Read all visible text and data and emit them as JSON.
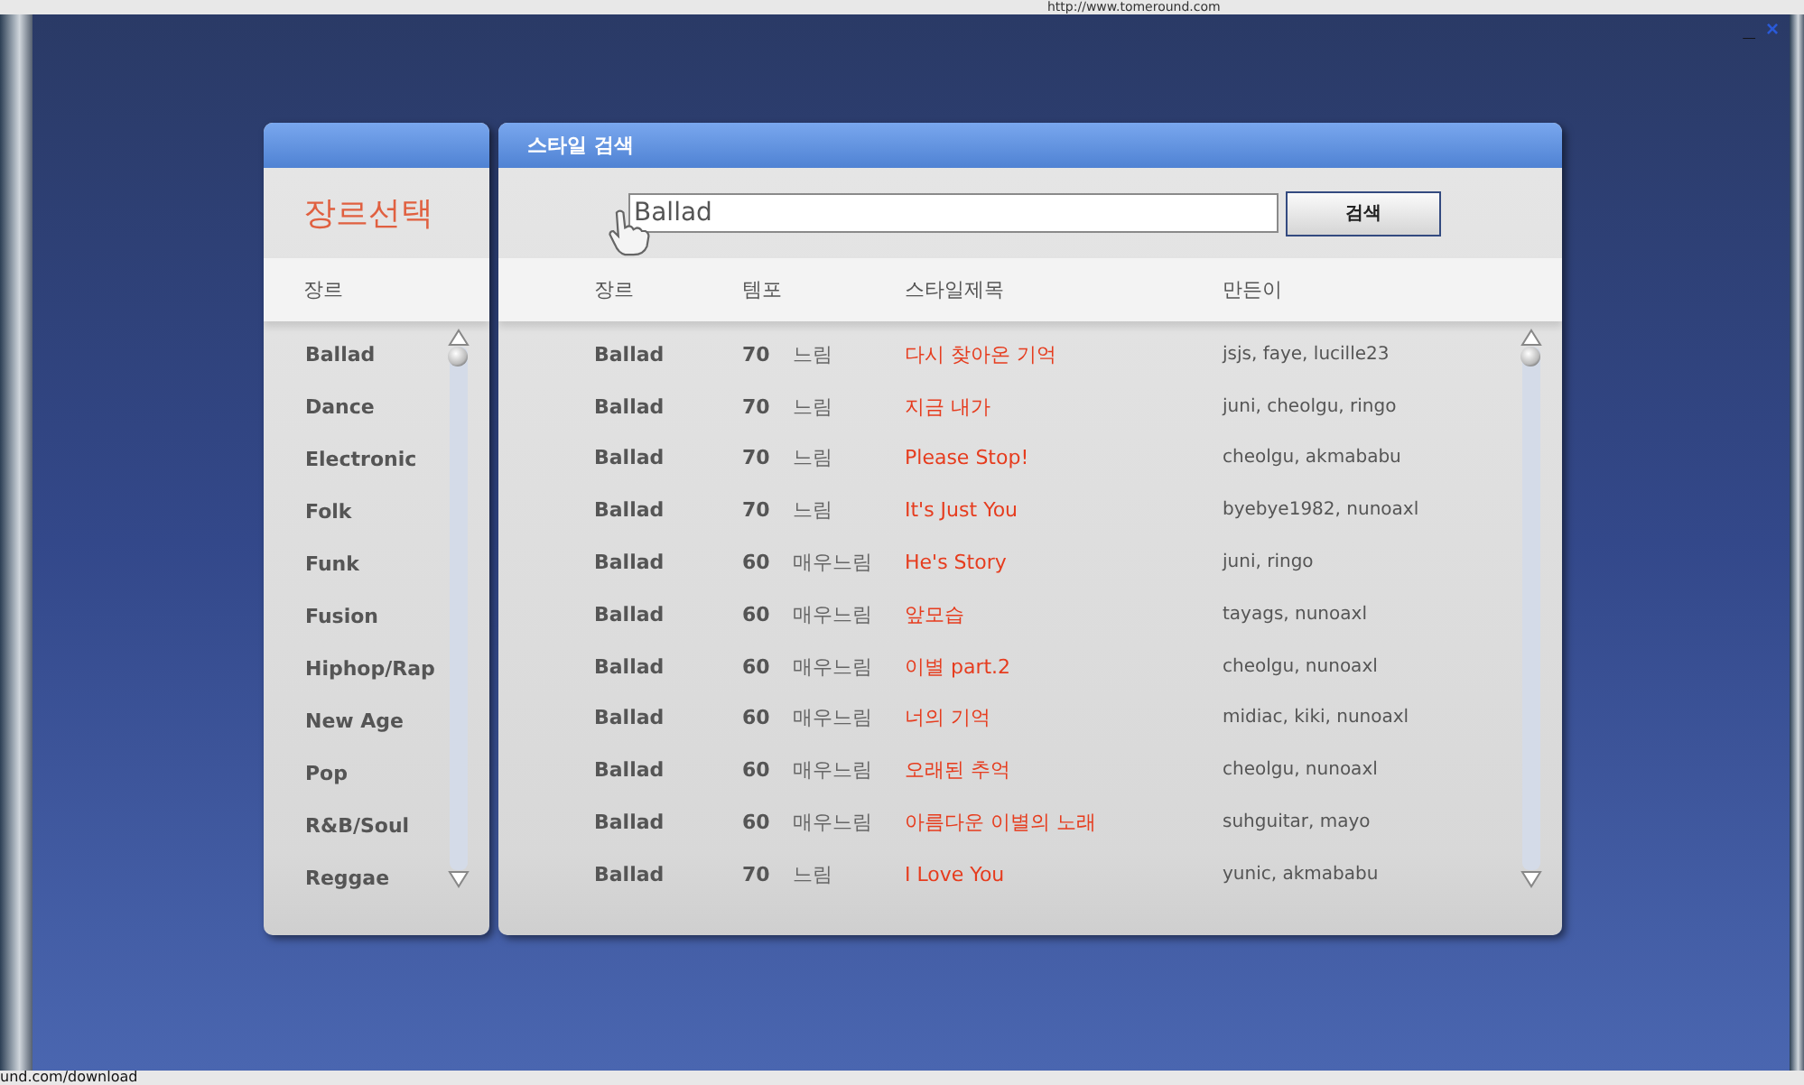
{
  "browser": {
    "url": "http://www.tomeround.com",
    "status": "und.com/download"
  },
  "window": {
    "controls": [
      "_",
      "×"
    ]
  },
  "genre_panel": {
    "title": "장르선택",
    "column": "장르",
    "items": [
      "Ballad",
      "Dance",
      "Electronic",
      "Folk",
      "Funk",
      "Fusion",
      "Hiphop/Rap",
      "New Age",
      "Pop",
      "R&B/Soul",
      "Reggae"
    ]
  },
  "search_panel": {
    "title": "스타일 검색",
    "search": {
      "value": "Ballad"
    },
    "button": "검색",
    "columns": [
      "장르",
      "템포",
      "스타일제목",
      "만든이"
    ],
    "rows": [
      {
        "genre": "Ballad",
        "bpm": "70",
        "tempo": "느림",
        "title": "다시 찾아온 기억",
        "makers": "jsjs, faye, lucille23"
      },
      {
        "genre": "Ballad",
        "bpm": "70",
        "tempo": "느림",
        "title": "지금 내가",
        "makers": "juni, cheolgu, ringo"
      },
      {
        "genre": "Ballad",
        "bpm": "70",
        "tempo": "느림",
        "title": "Please Stop!",
        "makers": "cheolgu, akmababu"
      },
      {
        "genre": "Ballad",
        "bpm": "70",
        "tempo": "느림",
        "title": "It's Just You",
        "makers": "byebye1982, nunoaxl"
      },
      {
        "genre": "Ballad",
        "bpm": "60",
        "tempo": "매우느림",
        "title": "He's Story",
        "makers": "juni, ringo"
      },
      {
        "genre": "Ballad",
        "bpm": "60",
        "tempo": "매우느림",
        "title": "앞모습",
        "makers": "tayags, nunoaxl"
      },
      {
        "genre": "Ballad",
        "bpm": "60",
        "tempo": "매우느림",
        "title": "이별 part.2",
        "makers": "cheolgu, nunoaxl"
      },
      {
        "genre": "Ballad",
        "bpm": "60",
        "tempo": "매우느림",
        "title": "너의 기억",
        "makers": "midiac, kiki, nunoaxl"
      },
      {
        "genre": "Ballad",
        "bpm": "60",
        "tempo": "매우느림",
        "title": "오래된 추억",
        "makers": "cheolgu, nunoaxl"
      },
      {
        "genre": "Ballad",
        "bpm": "60",
        "tempo": "매우느림",
        "title": "아름다운 이별의 노래",
        "makers": "suhguitar, mayo"
      },
      {
        "genre": "Ballad",
        "bpm": "70",
        "tempo": "느림",
        "title": "I Love You",
        "makers": "yunic, akmababu"
      }
    ]
  }
}
